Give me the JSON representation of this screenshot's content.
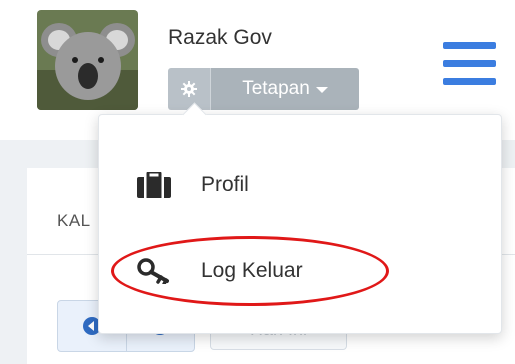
{
  "user": {
    "name": "Razak Gov",
    "avatar_icon": "koala-photo"
  },
  "settings_button": {
    "label": "Tetapan",
    "icon": "gear-icon"
  },
  "menu_icon": "hamburger-icon",
  "dropdown": {
    "items": [
      {
        "label": "Profil",
        "icon": "briefcase-icon"
      },
      {
        "label": "Log Keluar",
        "icon": "key-icon"
      }
    ]
  },
  "background_panel": {
    "title": "KAL",
    "period_button_label": "Hari Ini"
  },
  "colors": {
    "accent": "#3b7de0",
    "settings_bg": "#aab3ba",
    "highlight": "#e01818"
  }
}
